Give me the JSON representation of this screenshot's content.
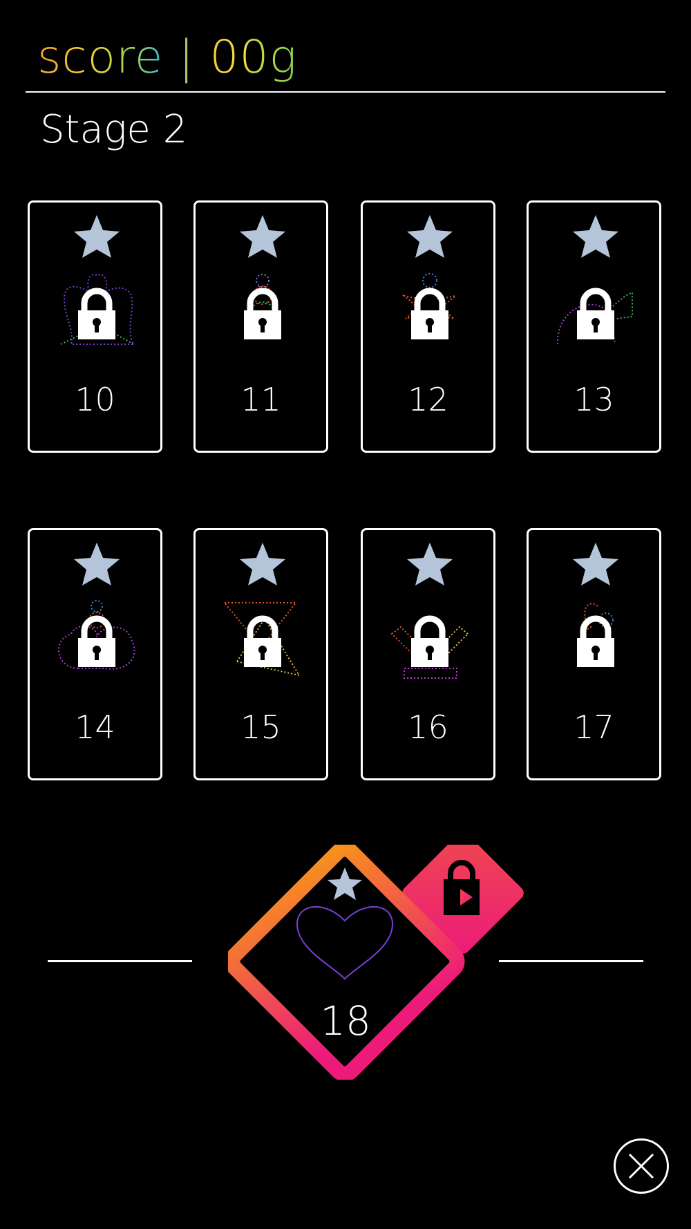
{
  "header": {
    "score_text": "score | 00g"
  },
  "stage": {
    "title": "Stage 2"
  },
  "levels": [
    {
      "number": "10",
      "shape": "angel"
    },
    {
      "number": "11",
      "shape": "snowman"
    },
    {
      "number": "12",
      "shape": "figure"
    },
    {
      "number": "13",
      "shape": "flower"
    },
    {
      "number": "14",
      "shape": "cloud-figure"
    },
    {
      "number": "15",
      "shape": "triangles"
    },
    {
      "number": "16",
      "shape": "arrows"
    },
    {
      "number": "17",
      "shape": "hook"
    }
  ],
  "featured": {
    "number": "18",
    "shape": "heart",
    "accent_from": "#f7901e",
    "accent_to": "#ec1b7a"
  },
  "icons": {
    "star": "star-icon",
    "lock": "lock-icon",
    "video": "play-video-icon",
    "close": "close-icon"
  },
  "colors": {
    "star": "#b4c4d9",
    "background": "#000000",
    "foreground": "#ffffff"
  }
}
